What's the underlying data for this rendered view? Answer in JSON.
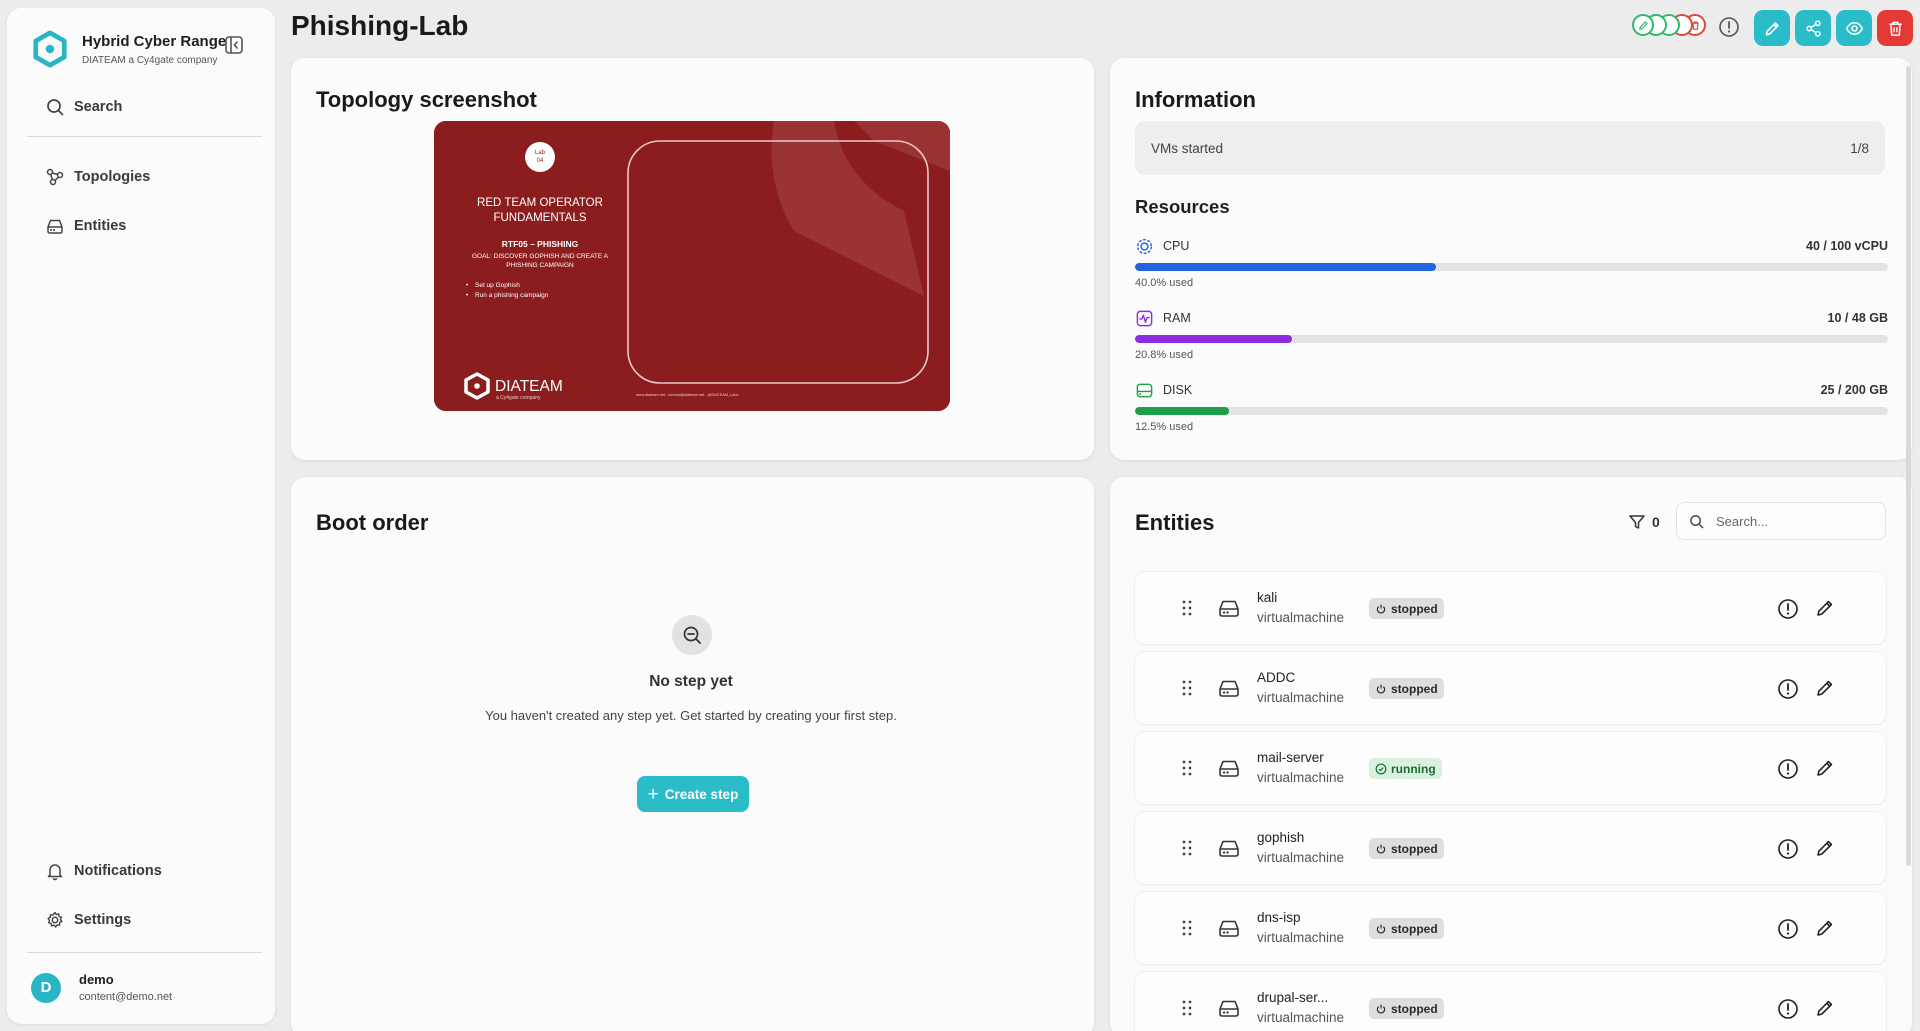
{
  "app": {
    "brand_title": "Hybrid Cyber Range",
    "brand_subtitle": "DIATEAM a Cy4gate company"
  },
  "sidebar": {
    "search_label": "Search",
    "items": [
      {
        "label": "Topologies",
        "icon": "topology-icon"
      },
      {
        "label": "Entities",
        "icon": "drive-icon"
      }
    ],
    "bottom_items": [
      {
        "label": "Notifications",
        "icon": "bell-icon"
      },
      {
        "label": "Settings",
        "icon": "gear-icon"
      }
    ],
    "user": {
      "initial": "D",
      "name": "demo",
      "email": "content@demo.net"
    }
  },
  "header": {
    "title": "Phishing-Lab",
    "status_colors": [
      "#2fb96b",
      "#2fb96b",
      "#2fb96b",
      "#e2453c",
      "#e2453c"
    ],
    "actions": [
      "edit-icon",
      "share-icon",
      "eye-icon",
      "trash-icon"
    ]
  },
  "topology": {
    "title": "Topology screenshot",
    "thumbnail": {
      "badge_line1": "Lab",
      "badge_line2": "04",
      "heading_line1": "RED TEAM OPERATOR",
      "heading_line2": "FUNDAMENTALS",
      "course": "RTF05 – PHISHING",
      "goal_line1": "GOAL: DISCOVER GOPHISH AND CREATE A",
      "goal_line2": "PHISHING CAMPAIGN",
      "bullets": [
        "Set up Gophish",
        "Run a phishing campaign"
      ],
      "logo_text": "DIATEAM",
      "logo_sub": "a Cy4gate company",
      "footer": "www.diateam.net - contact@diateam.net - @DIATEAM_Labs"
    }
  },
  "information": {
    "title": "Information",
    "vms_label": "VMs started",
    "vms_value": "1/8",
    "resources_title": "Resources",
    "resources": [
      {
        "name": "CPU",
        "value": "40 / 100 vCPU",
        "used": "40.0% used",
        "fraction": 0.4,
        "color": "#2166e0",
        "icon": "cpu-icon"
      },
      {
        "name": "RAM",
        "value": "10 / 48 GB",
        "used": "20.8% used",
        "fraction": 0.208,
        "color": "#8e2de0",
        "icon": "activity-icon"
      },
      {
        "name": "DISK",
        "value": "25 / 200 GB",
        "used": "12.5% used",
        "fraction": 0.125,
        "color": "#1e9e4a",
        "icon": "disk-icon"
      }
    ]
  },
  "boot_order": {
    "title": "Boot order",
    "empty_title": "No step yet",
    "empty_desc": "You haven't created any step yet. Get started by creating your first step.",
    "create_label": "Create step"
  },
  "entities": {
    "title": "Entities",
    "filter_count": "0",
    "search_placeholder": "Search...",
    "rows": [
      {
        "name": "kali",
        "type": "virtualmachine",
        "status": "stopped"
      },
      {
        "name": "ADDC",
        "type": "virtualmachine",
        "status": "stopped"
      },
      {
        "name": "mail-server",
        "type": "virtualmachine",
        "status": "running"
      },
      {
        "name": "gophish",
        "type": "virtualmachine",
        "status": "stopped"
      },
      {
        "name": "dns-isp",
        "type": "virtualmachine",
        "status": "stopped"
      },
      {
        "name": "drupal-ser...",
        "type": "virtualmachine",
        "status": "stopped"
      }
    ]
  }
}
